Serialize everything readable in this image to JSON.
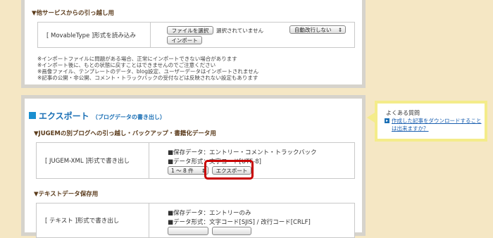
{
  "import_section": {
    "title": "▼他サービスからの引っ越し用",
    "row_label": "[ MovableType ]形式を読み込み",
    "file_button": "ファイルを選択",
    "file_status": "選択されていません",
    "linebreak_select": "自動改行しない",
    "import_button": "インポート",
    "notes": [
      "※インポートファイルに問題がある場合、正常にインポートできない場合があります",
      "※インポート後に、もとの状態に戻すことはできませんのでご注意ください",
      "※画像ファイル、テンプレートのデータ、blog設定、ユーザーデータはインポートされません",
      "※記事の公開・非公開、コメント・トラックバックの受付などは反映されない設定もあります"
    ]
  },
  "export_section": {
    "heading": "エクスポート",
    "heading_sub": "（ブログデータの書き出し）",
    "jugem_title": "▼JUGEMの別ブログへの引っ越し・バックアップ・書籍化データ用",
    "jugem_label": "[ JUGEM-XML ]形式で書き出し",
    "jugem_data": "■保存データ：エントリー・コメント・トラックバック",
    "jugem_format": "■データ形式：文字コード[UTF-8]",
    "range_select": "1 〜 8 件",
    "export_button": "エクスポート",
    "text_title": "▼テキストデータ保存用",
    "text_label": "[ テキスト ]形式で書き出し",
    "text_data": "■保存データ：エントリーのみ",
    "text_format": "■データ形式：文字コード[SJIS] / 改行コード[CRLF]"
  },
  "faq": {
    "title": "よくある質問",
    "link": "作成した記事をダウンロードすることは出来ますか？"
  }
}
